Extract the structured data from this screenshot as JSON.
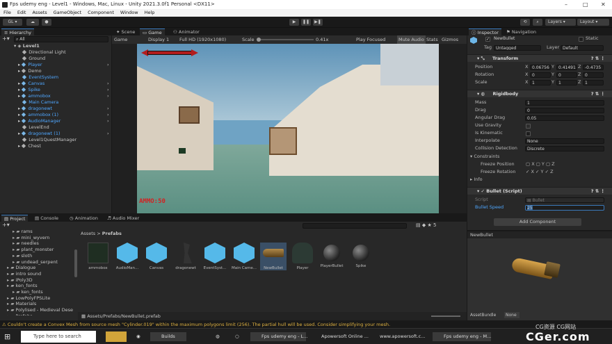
{
  "window": {
    "title": "Fps udemy eng - Level1 - Windows, Mac, Linux - Unity 2021.3.0f1 Personal <DX11>"
  },
  "menu": [
    "File",
    "Edit",
    "Assets",
    "GameObject",
    "Component",
    "Window",
    "Help"
  ],
  "toolbar": {
    "account": "GL",
    "layers": "Layers",
    "layout": "Layout"
  },
  "hierarchy": {
    "tab": "Hierarchy",
    "search_placeholder": "All",
    "scene": "Level1",
    "items": [
      {
        "label": "Directional Light",
        "indent": 1,
        "blue": false,
        "arrow": false
      },
      {
        "label": "Ground",
        "indent": 1,
        "blue": false,
        "arrow": false
      },
      {
        "label": "Player",
        "indent": 1,
        "blue": true,
        "arrow": true
      },
      {
        "label": "Demo",
        "indent": 1,
        "blue": false,
        "arrow": true
      },
      {
        "label": "EventSystem",
        "indent": 1,
        "blue": true,
        "arrow": false
      },
      {
        "label": "Canvas",
        "indent": 1,
        "blue": true,
        "arrow": true
      },
      {
        "label": "Spike",
        "indent": 1,
        "blue": true,
        "arrow": true
      },
      {
        "label": "ammobox",
        "indent": 1,
        "blue": true,
        "arrow": true
      },
      {
        "label": "Main Camera",
        "indent": 1,
        "blue": true,
        "arrow": false
      },
      {
        "label": "dragonewt",
        "indent": 1,
        "blue": true,
        "arrow": true
      },
      {
        "label": "ammobox (1)",
        "indent": 1,
        "blue": true,
        "arrow": true
      },
      {
        "label": "AudioManager",
        "indent": 1,
        "blue": true,
        "arrow": true
      },
      {
        "label": "LevelEnd",
        "indent": 1,
        "blue": false,
        "arrow": false
      },
      {
        "label": "dragonewt (1)",
        "indent": 1,
        "blue": true,
        "arrow": true
      },
      {
        "label": "Level1QuestManager",
        "indent": 1,
        "blue": false,
        "arrow": false
      },
      {
        "label": "Chest",
        "indent": 1,
        "blue": false,
        "arrow": true
      }
    ]
  },
  "scene_tabs": [
    "Scene",
    "Game",
    "Animator"
  ],
  "game_bar": {
    "mode": "Game",
    "display": "Display 1",
    "resolution": "Full HD (1920x1080)",
    "scale_label": "Scale",
    "scale_value": "0.41x",
    "play_focused": "Play Focused",
    "mute": "Mute Audio",
    "stats": "Stats",
    "gizmos": "Gizmos"
  },
  "hud": {
    "ammo": "AMMO:50"
  },
  "inspector": {
    "tabs": [
      "Inspector",
      "Navigation"
    ],
    "object_name": "NewBullet",
    "static_label": "Static",
    "tag_label": "Tag",
    "tag_value": "Untagged",
    "layer_label": "Layer",
    "layer_value": "Default",
    "transform": {
      "title": "Transform",
      "rows": [
        {
          "label": "Position",
          "x": "0.06756",
          "y": "0.41491",
          "z": "-0.4735"
        },
        {
          "label": "Rotation",
          "x": "0",
          "y": "0",
          "z": "0"
        },
        {
          "label": "Scale",
          "x": "1",
          "y": "1",
          "z": "1"
        }
      ]
    },
    "rigidbody": {
      "title": "Rigidbody",
      "mass_label": "Mass",
      "mass": "1",
      "drag_label": "Drag",
      "drag": "0",
      "angular_label": "Angular Drag",
      "angular": "0.05",
      "gravity_label": "Use Gravity",
      "kinematic_label": "Is Kinematic",
      "interpolate_label": "Interpolate",
      "interpolate": "None",
      "collision_label": "Collision Detection",
      "collision": "Discrete",
      "constraints_label": "Constraints",
      "freeze_pos_label": "Freeze Position",
      "freeze_rot_label": "Freeze Rotation",
      "info_label": "Info"
    },
    "script": {
      "title": "Bullet (Script)",
      "script_label": "Script",
      "script_value": "Bullet",
      "speed_label": "Bullet Speed",
      "speed_value": "25"
    },
    "add_component": "Add Component"
  },
  "preview": {
    "name": "NewBullet",
    "assetbundle": "AssetBundle",
    "none": "None"
  },
  "project": {
    "tabs": [
      "Project",
      "Console",
      "Animation",
      "Audio Mixer"
    ],
    "breadcrumb": [
      "Assets",
      "Prefabs"
    ],
    "count": "5",
    "tree": [
      "rams",
      "mini_wyvern",
      "needles",
      "plant_monster",
      "sloth",
      "undead_serpent",
      "Dialogue",
      "intro sound",
      "iPoly3D",
      "ken_fonts",
      "ken_fonts",
      "LowPolyFPSLite",
      "Materials",
      "Polylised - Medieval Dese",
      "Prefabs"
    ],
    "assets": [
      {
        "label": "ammobox",
        "kind": "dark"
      },
      {
        "label": "AudioMan...",
        "kind": "hex"
      },
      {
        "label": "Canvas",
        "kind": "hex"
      },
      {
        "label": "dragonewt",
        "kind": "figure"
      },
      {
        "label": "EventSyst...",
        "kind": "hex"
      },
      {
        "label": "Main Came...",
        "kind": "hex"
      },
      {
        "label": "NewBullet",
        "kind": "bullet"
      },
      {
        "label": "Player",
        "kind": "player"
      },
      {
        "label": "PlayerBullet",
        "kind": "sphere"
      },
      {
        "label": "Spike",
        "kind": "sphere"
      }
    ],
    "path": "Assets/Prefabs/NewBullet.prefab"
  },
  "status": {
    "warning": "Couldn't create a Convex Mesh from source mesh \"Cylinder.019\" within the maximum polygons limit (256). The partial hull will be used. Consider simplifying your mesh."
  },
  "taskbar": {
    "search": "Type here to search",
    "apps": [
      "Builds",
      "Fps udemy eng - L...",
      "Apowersoft Online ...",
      "www.apowersoft.c...",
      "Fps udemy eng - M..."
    ]
  },
  "watermark": {
    "main": "CGer.com",
    "sub": "CG资源 CG网站"
  }
}
